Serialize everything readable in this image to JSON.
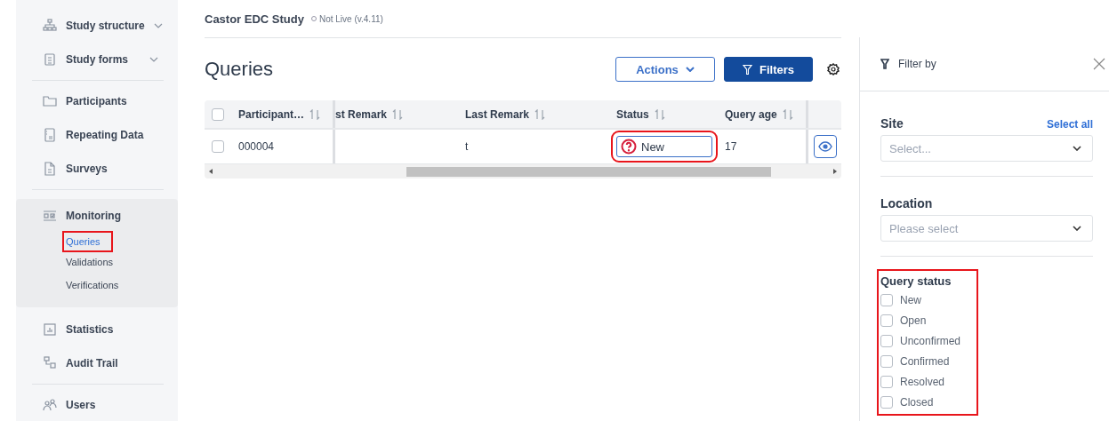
{
  "sidebar": {
    "sections": [
      {
        "items": [
          {
            "label": "Study structure",
            "expanded": false
          },
          {
            "label": "Study forms",
            "expanded": false
          }
        ]
      },
      {
        "items": [
          {
            "label": "Participants"
          },
          {
            "label": "Repeating Data"
          },
          {
            "label": "Surveys"
          }
        ]
      },
      {
        "group": {
          "label": "Monitoring",
          "children": [
            {
              "label": "Queries",
              "selected": true,
              "highlighted": true
            },
            {
              "label": "Validations",
              "selected": false,
              "highlighted": false
            },
            {
              "label": "Verifications",
              "selected": false,
              "highlighted": false
            }
          ]
        },
        "items": [
          {
            "label": "Statistics"
          },
          {
            "label": "Audit Trail"
          }
        ]
      },
      {
        "items": [
          {
            "label": "Users"
          }
        ]
      }
    ]
  },
  "header": {
    "study": "Castor EDC Study",
    "status": "Not Live (v.4.11)"
  },
  "page": {
    "title": "Queries",
    "buttons": [
      {
        "label": "Actions",
        "kind": "outline"
      },
      {
        "label": "Filters",
        "kind": "primary"
      }
    ]
  },
  "table": {
    "select_all": {
      "checked": false
    },
    "columns": [
      "Participant…",
      "st Remark",
      "Last Remark",
      "Status",
      "Query age"
    ],
    "rows": [
      {
        "checked": false,
        "cells": [
          "000004",
          "",
          "t",
          {
            "status": "New",
            "highlighted": true
          },
          "17"
        ]
      }
    ]
  },
  "filter_panel": {
    "title": "Filter by",
    "site": {
      "label": "Site",
      "action": "Select all",
      "placeholder": "Select..."
    },
    "location": {
      "label": "Location",
      "placeholder": "Please select"
    },
    "query_status": {
      "label": "Query status",
      "highlighted": true,
      "options": [
        {
          "label": "New",
          "checked": false
        },
        {
          "label": "Open",
          "checked": false
        },
        {
          "label": "Unconfirmed",
          "checked": false
        },
        {
          "label": "Confirmed",
          "checked": false
        },
        {
          "label": "Resolved",
          "checked": false
        },
        {
          "label": "Closed",
          "checked": false
        }
      ]
    }
  }
}
